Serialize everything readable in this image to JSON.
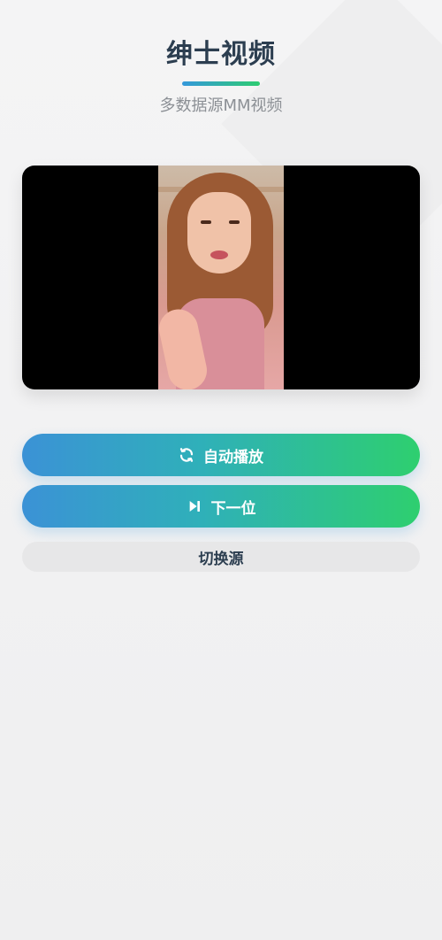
{
  "header": {
    "title": "绅士视频",
    "subtitle": "多数据源MM视频"
  },
  "player": {
    "state": "playing"
  },
  "buttons": {
    "auto_play": {
      "label": "自动播放",
      "icon": "refresh-icon"
    },
    "next": {
      "label": "下一位",
      "icon": "skip-forward-icon"
    },
    "switch_source": {
      "label": "切换源"
    }
  },
  "colors": {
    "title": "#2c3e50",
    "subtitle": "#8c9095",
    "gradient_start": "#3498db",
    "gradient_end": "#2ecc71",
    "background": "#f2f2f3"
  }
}
